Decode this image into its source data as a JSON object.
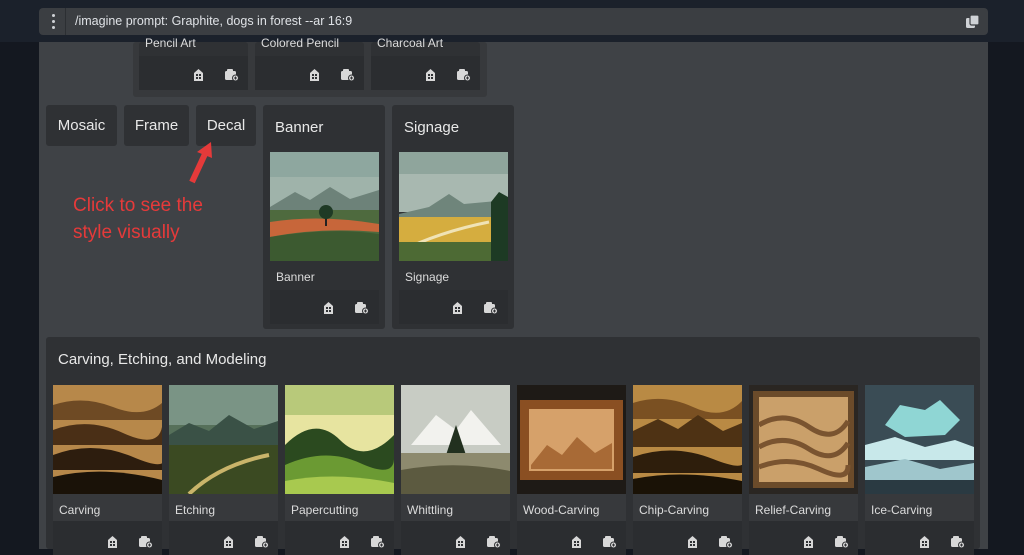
{
  "prompt": {
    "text": "/imagine prompt: Graphite, dogs in forest --ar 16:9"
  },
  "top_cards": [
    {
      "label": "Pencil Art"
    },
    {
      "label": "Colored Pencil"
    },
    {
      "label": "Charcoal Art"
    }
  ],
  "buttons": {
    "mosaic": "Mosaic",
    "frame": "Frame",
    "decal": "Decal"
  },
  "banner": {
    "title": "Banner",
    "tile_label": "Banner"
  },
  "signage": {
    "title": "Signage",
    "tile_label": "Signage"
  },
  "annotation": {
    "line1": "Click to see the",
    "line2": "style visually"
  },
  "carving_section": {
    "title": "Carving, Etching, and Modeling",
    "items": [
      {
        "label": "Carving"
      },
      {
        "label": "Etching"
      },
      {
        "label": "Papercutting"
      },
      {
        "label": "Whittling"
      },
      {
        "label": "Wood-Carving"
      },
      {
        "label": "Chip-Carving"
      },
      {
        "label": "Relief-Carving"
      },
      {
        "label": "Ice-Carving"
      }
    ]
  },
  "colors": {
    "annotation": "#e53a3a",
    "panel": "#3f4246",
    "card": "#2f3134"
  },
  "icons": {
    "prompt_menu": "vertical-dots-icon",
    "copy": "copy-icon",
    "tile_a": "building-icon",
    "tile_b": "camera-icon"
  }
}
